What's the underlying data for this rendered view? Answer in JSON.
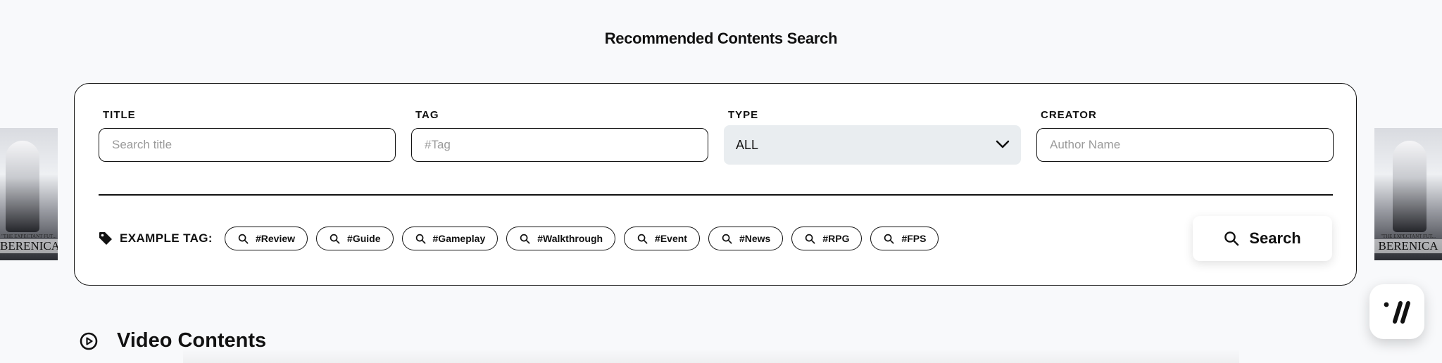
{
  "page_title": "Recommended Contents Search",
  "search_form": {
    "title": {
      "label": "TITLE",
      "placeholder": "Search title",
      "value": ""
    },
    "tag": {
      "label": "TAG",
      "placeholder": "#Tag",
      "value": ""
    },
    "type": {
      "label": "TYPE",
      "selected": "ALL"
    },
    "creator": {
      "label": "CREATOR",
      "placeholder": "Author Name",
      "value": ""
    },
    "example_tag_label": "EXAMPLE TAG:",
    "example_tags": [
      "#Review",
      "#Guide",
      "#Gameplay",
      "#Walkthrough",
      "#Event",
      "#News",
      "#RPG",
      "#FPS"
    ],
    "search_button_label": "Search"
  },
  "side_covers": {
    "subtitle": "\"THE EXPECTANT FUT...",
    "title_left": "BERENICA",
    "title_right": "BERENICA"
  },
  "section": {
    "title": "Video Contents",
    "icon": "play-circle-icon"
  },
  "colors": {
    "border": "#111111",
    "select_bg": "#e9edf0",
    "page_bg": "#f8f9fb"
  }
}
